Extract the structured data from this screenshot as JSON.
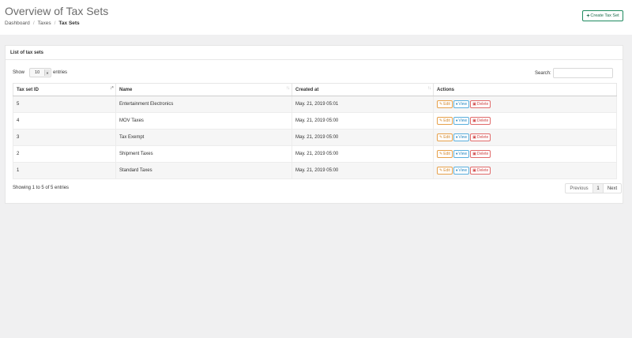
{
  "header": {
    "title": "Overview of Tax Sets",
    "breadcrumb": [
      "Dashboard",
      "Taxes",
      "Tax Sets"
    ],
    "create_label": "Create Tax Set"
  },
  "card": {
    "title": "List of tax sets",
    "show_label": "Show",
    "entries_value": "10",
    "entries_label": "entries",
    "search_label": "Search:",
    "search_value": ""
  },
  "table": {
    "columns": [
      "Tax set ID",
      "Name",
      "Created at",
      "Actions"
    ],
    "rows": [
      {
        "id": "5",
        "name": "Entertainment Electronics",
        "created": "May. 21, 2019 05:01"
      },
      {
        "id": "4",
        "name": "MOV Taxes",
        "created": "May. 21, 2019 05:00"
      },
      {
        "id": "3",
        "name": "Tax Exempt",
        "created": "May. 21, 2019 05:00"
      },
      {
        "id": "2",
        "name": "Shipment Taxes",
        "created": "May. 21, 2019 05:00"
      },
      {
        "id": "1",
        "name": "Standard Taxes",
        "created": "May. 21, 2019 05:00"
      }
    ],
    "actions": {
      "edit": "Edit",
      "view": "View",
      "delete": "Delete"
    }
  },
  "footer": {
    "info": "Showing 1 to 5 of 5 entries",
    "previous": "Previous",
    "page": "1",
    "next": "Next"
  },
  "colors": {
    "create_border": "#1e8a5f",
    "edit": "#e6a04a",
    "view": "#5aaedc",
    "delete": "#e06a6a"
  }
}
